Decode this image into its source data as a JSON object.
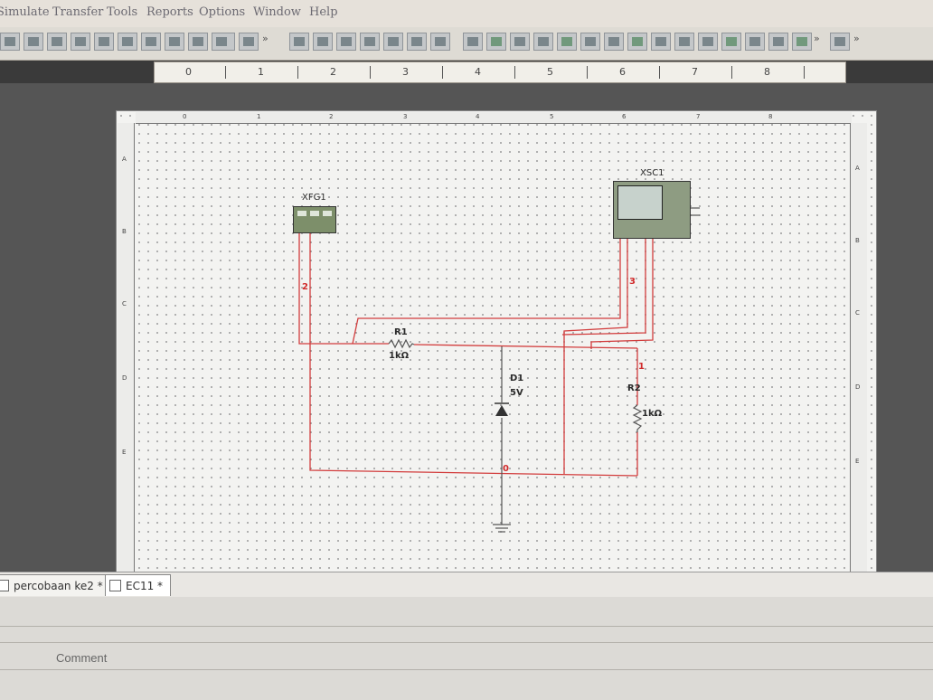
{
  "menu": {
    "items": [
      "Simulate",
      "Transfer",
      "Tools",
      "Reports",
      "Options",
      "Window",
      "Help"
    ]
  },
  "toolbar": {
    "chevron": "»"
  },
  "ruler": {
    "marks": [
      "0",
      "1",
      "2",
      "3",
      "4",
      "5",
      "6",
      "7",
      "8"
    ]
  },
  "sheet_ruler": {
    "columns": [
      "0",
      "1",
      "2",
      "3",
      "4",
      "5",
      "6",
      "7",
      "8"
    ],
    "rows": [
      "A",
      "B",
      "C",
      "D",
      "E"
    ]
  },
  "schematic": {
    "xfg1": "XFG1",
    "xsc1": "XSC1",
    "r1_name": "R1",
    "r1_value": "1kΩ",
    "d1_name": "D1",
    "d1_value": "5V",
    "r2_name": "R2",
    "r2_value": "1kΩ",
    "net_2": "2",
    "net_3": "3",
    "net_1": "1",
    "net_0": "0",
    "wire_color": "#d23c3c"
  },
  "tabs": [
    {
      "label": "percobaan ke2 *"
    },
    {
      "label": "EC11 *"
    }
  ],
  "spreadsheet": {
    "comment_label": "Comment"
  }
}
